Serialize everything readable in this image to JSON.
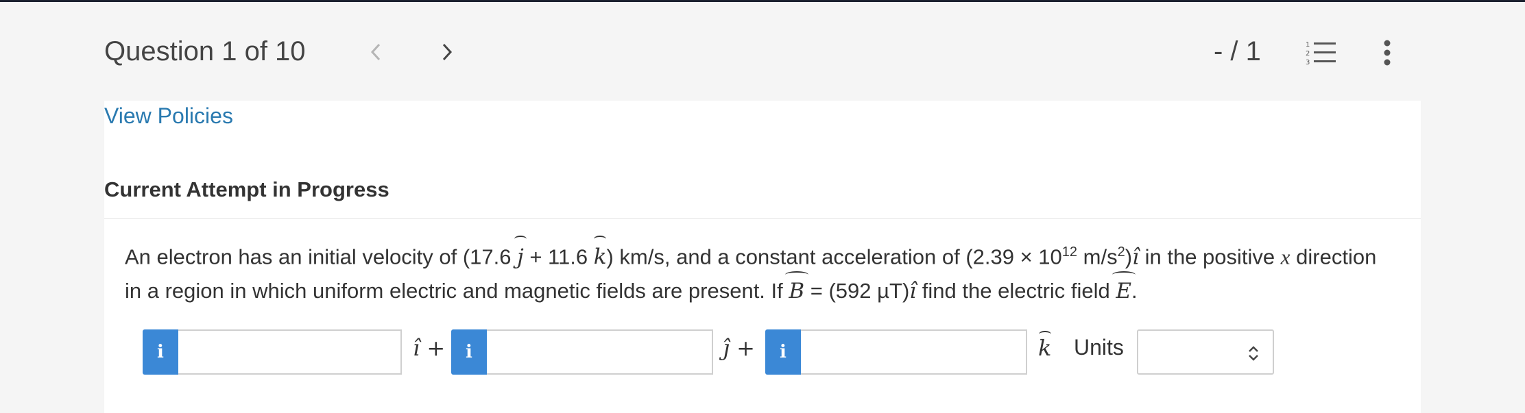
{
  "header": {
    "question_label": "Question 1 of 10",
    "score": "- / 1"
  },
  "links": {
    "policies": "View Policies"
  },
  "attempt_heading": "Current Attempt in Progress",
  "question": {
    "p1": "An electron has an initial velocity of (17.6 ",
    "j": "j",
    "p2": " + 11.6 ",
    "k": "k",
    "p3": ") km/s, and a constant acceleration of (2.39 × 10",
    "exp": "12",
    "p4": " m/s",
    "sq": "2",
    "p5": ")",
    "i": "î",
    "p6": " in the positive ",
    "x": "x",
    "p7": " direction",
    "p8": "in a region in which uniform electric and magnetic fields are present. If ",
    "B": "B",
    "p9": " = (592 µT)",
    "p10": " find the electric field ",
    "E": "E",
    "p11": "."
  },
  "answer": {
    "info_glyph": "i",
    "unit_i": "î +",
    "unit_j": "ĵ +",
    "unit_k": "k",
    "units_label": "Units",
    "input_i_value": "",
    "input_j_value": "",
    "input_k_value": "",
    "units_selected": ""
  },
  "colors": {
    "link": "#2a7ab0",
    "info_button": "#3b88d6",
    "top_border": "#1c2230"
  }
}
